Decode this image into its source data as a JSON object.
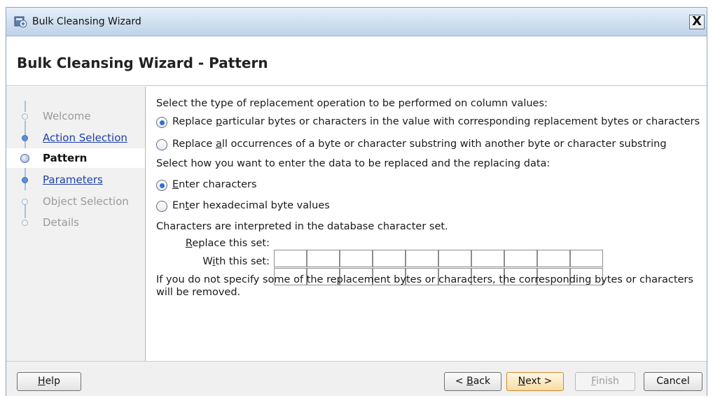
{
  "window": {
    "title": "Bulk Cleansing Wizard",
    "close_label": "X"
  },
  "header": {
    "title": "Bulk Cleansing Wizard - Pattern"
  },
  "nav": {
    "items": [
      {
        "label": "Welcome",
        "state": "pending"
      },
      {
        "label": "Action Selection",
        "state": "done"
      },
      {
        "label": "Pattern",
        "state": "current"
      },
      {
        "label": "Parameters",
        "state": "done"
      },
      {
        "label": "Object Selection",
        "state": "pending"
      },
      {
        "label": "Details",
        "state": "pending"
      }
    ]
  },
  "content": {
    "replacement_prompt": "Select the type of replacement operation to be performed on column values:",
    "replacement_options": [
      {
        "pre": "Replace ",
        "key": "p",
        "post": "articular bytes or characters in the value with corresponding replacement bytes or characters",
        "selected": true
      },
      {
        "pre": "Replace ",
        "key": "a",
        "post": "ll occurrences of a byte or character substring with another byte or character substring",
        "selected": false
      }
    ],
    "entry_prompt": "Select how you want to enter the data to be replaced and the replacing data:",
    "entry_options": [
      {
        "pre": "",
        "key": "E",
        "post": "nter characters",
        "selected": true
      },
      {
        "pre": "En",
        "key": "t",
        "post": "er hexadecimal byte values",
        "selected": false
      }
    ],
    "charset_note": "Characters are interpreted in the database character set.",
    "replace_set": {
      "pre": "",
      "key": "R",
      "post": "eplace this set:",
      "values": [
        "",
        "",
        "",
        "",
        "",
        "",
        "",
        "",
        "",
        ""
      ]
    },
    "with_set": {
      "pre": "W",
      "key": "i",
      "post": "th this set:",
      "values": [
        "",
        "",
        "",
        "",
        "",
        "",
        "",
        "",
        "",
        ""
      ]
    },
    "removal_note_line1": "If you do not specify some of the replacement bytes or characters, the corresponding bytes or characters",
    "removal_note_line2": "will be removed."
  },
  "footer": {
    "help": {
      "pre": "",
      "key": "H",
      "post": "elp"
    },
    "back": {
      "pre": "< ",
      "key": "B",
      "post": "ack"
    },
    "next": {
      "pre": "",
      "key": "N",
      "post": "ext >"
    },
    "finish": {
      "pre": "",
      "key": "F",
      "post": "inish"
    },
    "cancel": {
      "pre": "Cancel",
      "key": "",
      "post": ""
    }
  },
  "colors": {
    "accent": "#2e6fd6",
    "link": "#1c3fa8",
    "titlebar": "#cfdfef"
  },
  "icons": {
    "app": "wizard-app-icon",
    "close": "close-icon"
  }
}
